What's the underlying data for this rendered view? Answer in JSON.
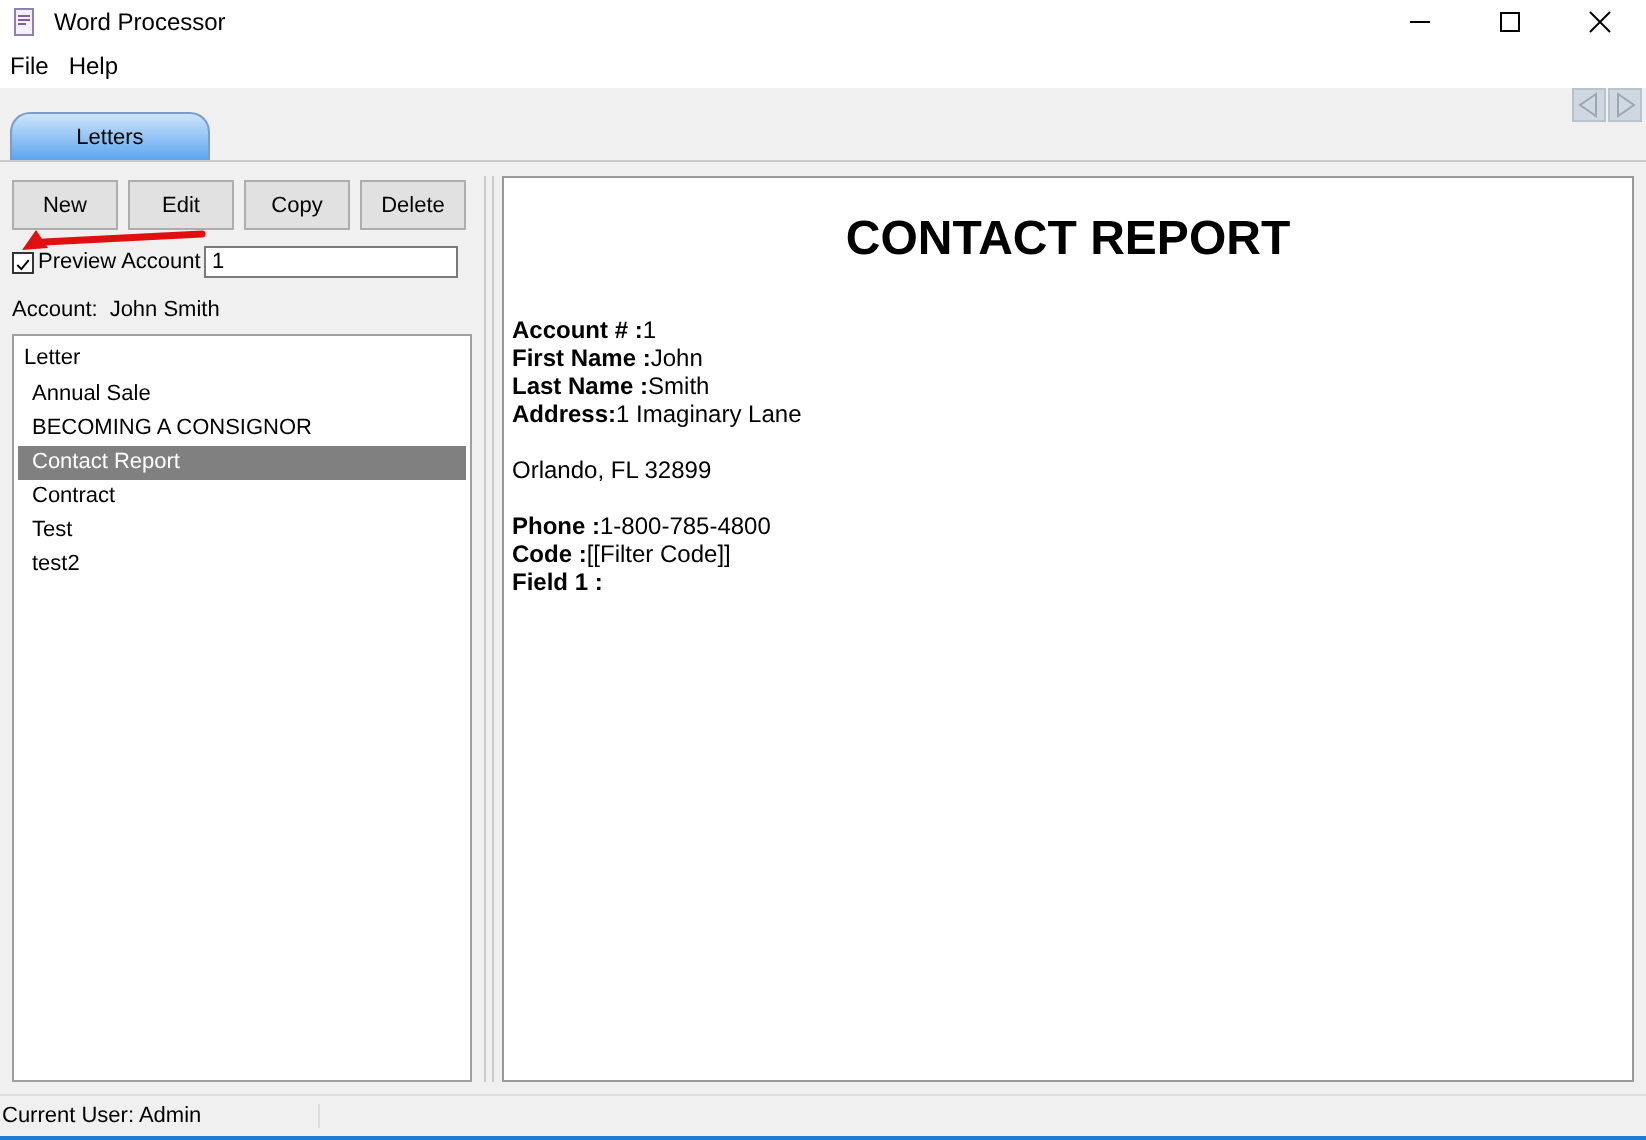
{
  "window": {
    "title": "Word Processor"
  },
  "menu": [
    "File",
    "Help"
  ],
  "tabs": [
    {
      "label": "Letters",
      "selected": true
    }
  ],
  "buttons": [
    "New",
    "Edit",
    "Copy",
    "Delete"
  ],
  "preview": {
    "label": "Preview Account",
    "checked": true,
    "value": "1"
  },
  "account": {
    "label": "Account:",
    "value": "John Smith"
  },
  "tree": {
    "label": "Letter",
    "children": [
      {
        "label": "Annual Sale",
        "selected": false
      },
      {
        "label": "BECOMING A CONSIGNOR",
        "selected": false
      },
      {
        "label": "Contact Report",
        "selected": true
      },
      {
        "label": "Contract",
        "selected": false
      },
      {
        "label": "Test",
        "selected": false
      },
      {
        "label": "test2",
        "selected": false
      }
    ]
  },
  "document": {
    "title": "CONTACT REPORT",
    "blocks": [
      [
        "**Account # :**1",
        "**First Name :**John",
        "**Last Name :**Smith",
        "**Address:**1 Imaginary Lane"
      ],
      [
        "Orlando, FL  32899"
      ],
      [
        "**Phone :**1-800-785-4800",
        "**Code :**[[Filter Code]]",
        "**Field 1 :**"
      ]
    ]
  },
  "status_bar": "Current User: Admin"
}
